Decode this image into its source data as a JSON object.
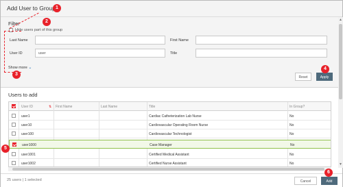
{
  "dialog": {
    "title": "Add User to Group"
  },
  "filter": {
    "title": "Filter",
    "hide_label": "Hide users part of this group",
    "last_name_label": "Last Name",
    "last_name_value": "",
    "first_name_label": "First Name",
    "first_name_value": "",
    "user_id_label": "User ID",
    "user_id_value": "user",
    "title_label": "Title",
    "title_value": "",
    "show_more": "Show more",
    "reset_label": "Reset",
    "apply_label": "Apply"
  },
  "users": {
    "title": "Users to add",
    "columns": [
      "User ID",
      "First Name",
      "Last Name",
      "Title",
      "In Group?"
    ],
    "rows": [
      {
        "id": "user1",
        "first": "",
        "last": "",
        "title": "Cardiac Catheterization Lab Nurse",
        "in_group": "No",
        "checked": false
      },
      {
        "id": "user10",
        "first": "",
        "last": "",
        "title": "Cardiovascular Operating Room Nurse",
        "in_group": "No",
        "checked": false
      },
      {
        "id": "user100",
        "first": "",
        "last": "",
        "title": "Cardiovascular Technologist",
        "in_group": "No",
        "checked": false
      },
      {
        "id": "user1000",
        "first": "",
        "last": "",
        "title": "Case Manager",
        "in_group": "No",
        "checked": true
      },
      {
        "id": "user1001",
        "first": "",
        "last": "",
        "title": "Certified Medical Assistant",
        "in_group": "No",
        "checked": false
      },
      {
        "id": "user1002",
        "first": "",
        "last": "",
        "title": "Certified Nurse Assistant",
        "in_group": "No",
        "checked": false
      }
    ]
  },
  "footer": {
    "status": "25 users | 1 selected",
    "cancel_label": "Cancel",
    "add_label": "Add"
  },
  "callouts": [
    "1",
    "2",
    "3",
    "4",
    "5",
    "6"
  ],
  "colors": {
    "callout": "#e8212a",
    "primary_button": "#4e6a7c",
    "selected_row_border": "#8fc14b"
  }
}
